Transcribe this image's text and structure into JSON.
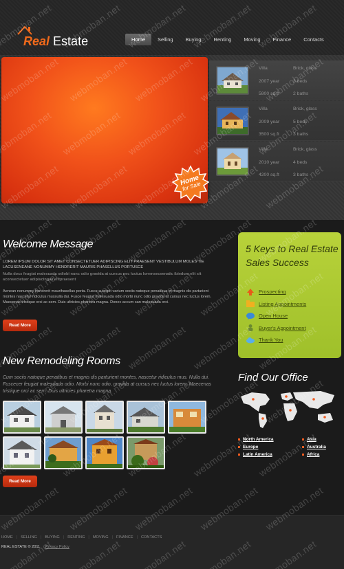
{
  "header": {
    "logo": {
      "part_a": "Real",
      "part_b": "Estate"
    },
    "nav": [
      {
        "label": "Home",
        "active": true
      },
      {
        "label": "Selling",
        "active": false
      },
      {
        "label": "Buying",
        "active": false
      },
      {
        "label": "Renting",
        "active": false
      },
      {
        "label": "Moving",
        "active": false
      },
      {
        "label": "Finance",
        "active": false
      },
      {
        "label": "Contacts",
        "active": false
      }
    ]
  },
  "hero": {
    "badge": {
      "line1": "Home",
      "line2": "for Sale"
    },
    "listings": [
      {
        "type": "Villa",
        "year": "2007 year",
        "area": "5800 sq.ft",
        "material": "Brick, glass",
        "beds": "3 beds",
        "baths": "2 baths"
      },
      {
        "type": "Villa",
        "year": "2009 year",
        "area": "3500 sq.ft",
        "material": "Brick, glass",
        "beds": "5 beds",
        "baths": "3 baths"
      },
      {
        "type": "Villa",
        "year": "2010 year",
        "area": "4200 sq.ft",
        "material": "Brick, glass",
        "beds": "4 beds",
        "baths": "3 baths"
      }
    ]
  },
  "welcome": {
    "title": "Welcome Message",
    "caps": "LOREM IPSUM DOLOR SIT AMET CONSECTETUER ADIPISCING ELIT PRAESENT VESTIBULUM MOLES TIE LACUSENEANE NONUMMY HENDRERIT MAURIS PHASELLUS PORTUSCE",
    "subcaps": "Nulla docx feugiat malesuada odiobi nunc odio gravida at cursus nec luctus loremsecvenatic ibiedum elit sit aconsectetuer adipiscingas elitpraesent",
    "body": "Aenean nonummy hendrerit maurihasellus porta. Fusce suscipit varium sociis natoque penatibus et magnis dis parturient montes nascetur ridiculus mussulla dui. Fusce feugiat malesuada odio morbi nunc odio gravida at cursus nec luctus lorem. Maecenas tristique orci ac sem. Duis ultricies pharetra magna. Donec accum san malesuada orci.",
    "button": "Read More"
  },
  "remodeling": {
    "title": "New Remodeling Rooms",
    "body": "Cum sociis natoque penatibus et magnis dis parturient montes, nascetur ridiculus mus. Nulla dui. Fuscecer feugiat malesuada odio. Morbi nunc odio, gravida at cursus nec luctus lorem. Maecenas tristique orci ac sem. Duis ultricies pharetra magna.",
    "button": "Read More",
    "thumbs": 9
  },
  "keys": {
    "title": "5 Keys to Real Estate Sales Success",
    "items": [
      {
        "label": "Prospecting",
        "icon": "arrow-up-icon"
      },
      {
        "label": "Listing Appointments",
        "icon": "folder-icon"
      },
      {
        "label": "Open House",
        "icon": "speech-bubble-icon"
      },
      {
        "label": "Buyer's Appointment",
        "icon": "person-icon"
      },
      {
        "label": "Thank You",
        "icon": "cloud-icon"
      }
    ]
  },
  "office": {
    "title": "Find Our Office",
    "regions": [
      "North America",
      "Asia",
      "Europe",
      "Australia",
      "Latin America",
      "Africa"
    ]
  },
  "footer": {
    "nav": [
      "HOME",
      "SELLING",
      "BUYING",
      "RENTING",
      "MOVING",
      "FINANCE",
      "CONTACTS"
    ],
    "copyright": "REAL ESTATE © 2011",
    "privacy": "Privacy Policy"
  },
  "watermark": "webmoban.net",
  "colors": {
    "accent": "#f26a1b",
    "green_panel": "#b0cb33",
    "bg": "#1b1b1b"
  }
}
